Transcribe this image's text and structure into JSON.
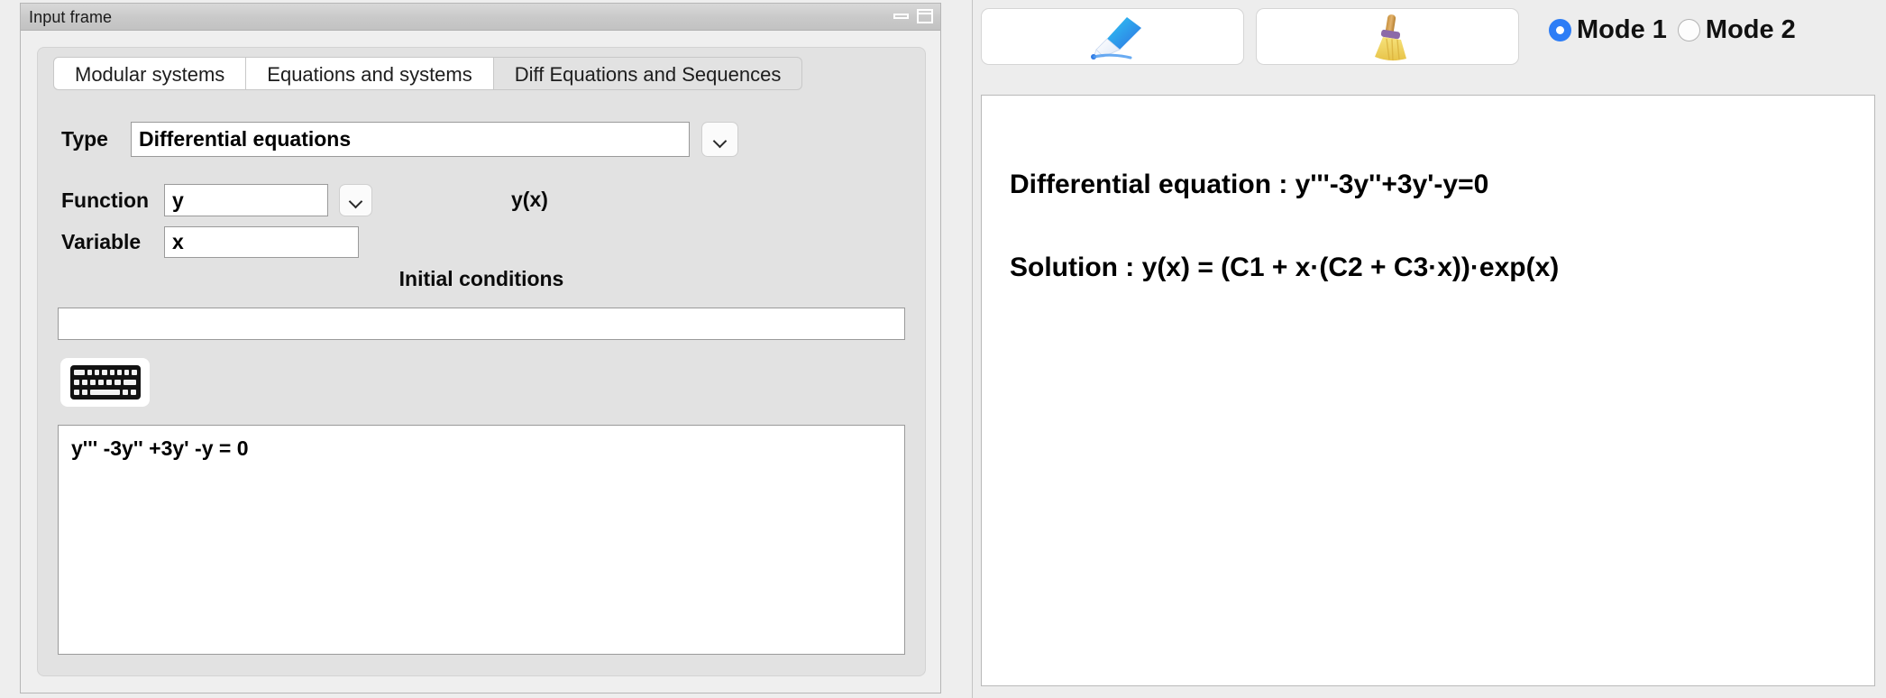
{
  "window": {
    "title": "Input frame",
    "controls": [
      {
        "name": "minimize",
        "label": "–"
      },
      {
        "name": "maximize",
        "label": "□"
      }
    ]
  },
  "tabs": [
    {
      "label": "Modular systems",
      "active": false
    },
    {
      "label": "Equations and systems",
      "active": false
    },
    {
      "label": "Diff Equations and Sequences",
      "active": true
    }
  ],
  "form": {
    "type": {
      "label": "Type",
      "value": "Differential equations",
      "dropdown_icon": "chevron-down-icon"
    },
    "function": {
      "label": "Function",
      "value": "y",
      "dropdown_icon": "chevron-down-icon",
      "display": "y(x)"
    },
    "variable": {
      "label": "Variable",
      "value": "x"
    },
    "initial_conditions": {
      "heading": "Initial conditions",
      "value": "",
      "placeholder": ""
    },
    "keyboard_button": {
      "icon": "keyboard-icon"
    },
    "equation_input": {
      "value": "y''' -3y'' +3y' -y = 0",
      "placeholder": ""
    }
  },
  "toolbar": {
    "compute_button": {
      "icon": "pen-icon"
    },
    "clear_button": {
      "icon": "broom-icon"
    },
    "modes": [
      {
        "label": "Mode 1",
        "selected": true
      },
      {
        "label": "Mode 2",
        "selected": false
      }
    ]
  },
  "output": {
    "equation_line": "Differential equation :  y'''-3y''+3y'-y=0",
    "solution_line": "Solution :  y(x) = (C1 + x·(C2 + C3·x))·exp(x)"
  },
  "colors": {
    "accent": "#2d7df6",
    "panel_bg": "#e2e2e2",
    "window_bg": "#ededed",
    "field_bg": "#ffffff"
  }
}
